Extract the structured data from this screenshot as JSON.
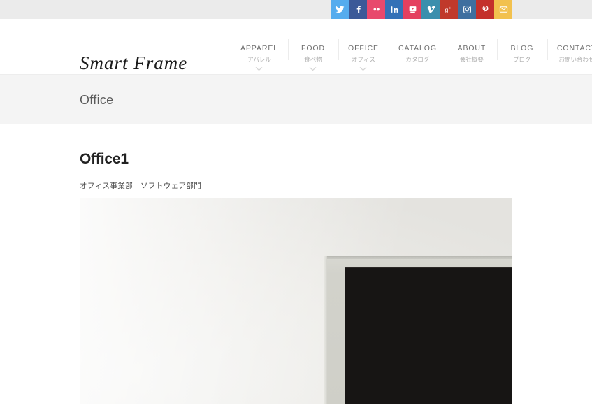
{
  "topbar": {
    "social_links": [
      {
        "name": "twitter",
        "label": "Twitter",
        "color": "#55acee",
        "glyph": "twitter"
      },
      {
        "name": "facebook",
        "label": "Facebook",
        "color": "#3b5998",
        "glyph": "facebook"
      },
      {
        "name": "flickr",
        "label": "Flickr",
        "color": "#e8496d",
        "glyph": "flickr"
      },
      {
        "name": "linkedin",
        "label": "LinkedIn",
        "color": "#3371b7",
        "glyph": "linkedin"
      },
      {
        "name": "youtube",
        "label": "YouTube",
        "color": "#e4405f",
        "glyph": "youtube"
      },
      {
        "name": "vimeo",
        "label": "Vimeo",
        "color": "#3b8fad",
        "glyph": "vimeo"
      },
      {
        "name": "googleplus",
        "label": "Google+",
        "color": "#c0392b",
        "glyph": "googleplus"
      },
      {
        "name": "instagram",
        "label": "Instagram",
        "color": "#3f6f9f",
        "glyph": "instagram"
      },
      {
        "name": "pinterest",
        "label": "Pinterest",
        "color": "#c4302b",
        "glyph": "pinterest"
      },
      {
        "name": "email",
        "label": "Email",
        "color": "#f2c14e",
        "glyph": "email"
      }
    ]
  },
  "header": {
    "logo_text": "Smart Frame",
    "nav": [
      {
        "en": "APPAREL",
        "jp": "アパレル",
        "has_submenu": true
      },
      {
        "en": "FOOD",
        "jp": "食べ物",
        "has_submenu": true
      },
      {
        "en": "OFFICE",
        "jp": "オフィス",
        "has_submenu": true
      },
      {
        "en": "CATALOG",
        "jp": "カタログ",
        "has_submenu": false
      },
      {
        "en": "ABOUT",
        "jp": "会社概要",
        "has_submenu": false
      },
      {
        "en": "BLOG",
        "jp": "ブログ",
        "has_submenu": false
      },
      {
        "en": "CONTACT",
        "jp": "お問い合わせ",
        "has_submenu": false
      }
    ]
  },
  "page_title": "Office",
  "entry": {
    "title": "Office1",
    "meta": "オフィス事業部　ソフトウェア部門",
    "image_alt": "Computer monitor on a white office wall"
  },
  "colors": {
    "topbar_bg": "#ebebeb",
    "title_band_bg": "#f4f4f4",
    "page_bg": "#ffffff",
    "nav_en_text": "#6e6e6e",
    "nav_jp_text": "#b0b0b0",
    "heading_text": "#222222"
  }
}
